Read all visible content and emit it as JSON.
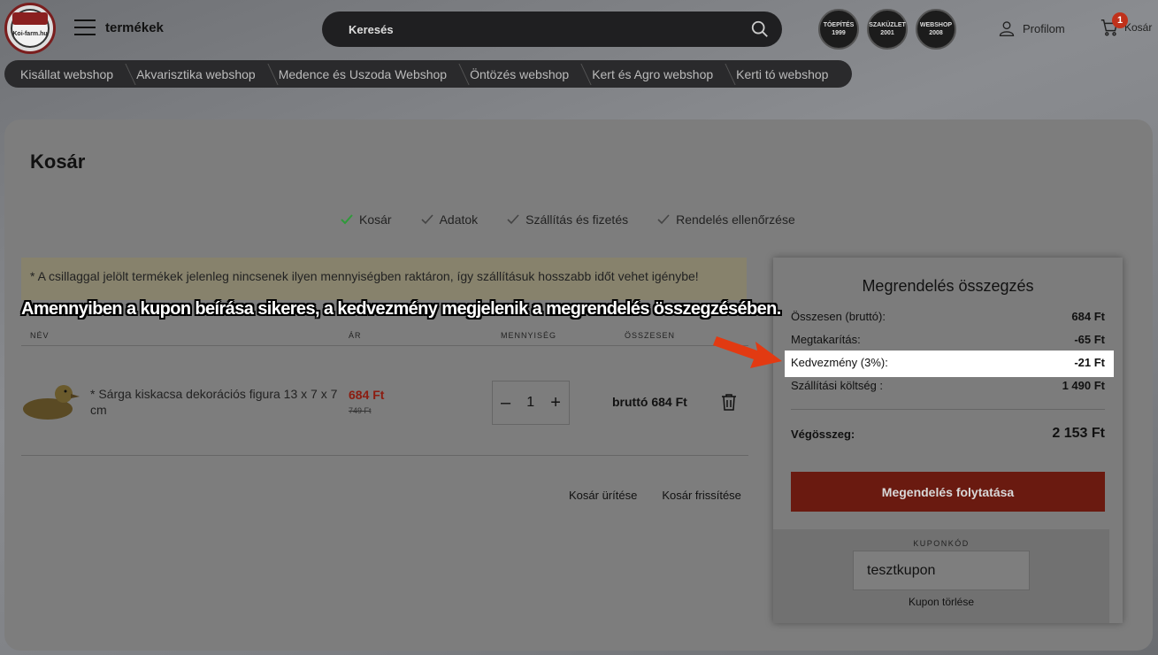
{
  "header": {
    "logo_text": "Koi-farm.hu",
    "menu_label": "termékek",
    "search_placeholder": "Keresés",
    "badges": [
      {
        "line1": "TÓEPÍTÉS",
        "line2": "1999"
      },
      {
        "line1": "SZAKÜZLET",
        "line2": "2001"
      },
      {
        "line1": "WEBSHOP",
        "line2": "2008"
      }
    ],
    "profile_label": "Profilom",
    "cart_label": "Kosár",
    "cart_count": "1"
  },
  "nav": {
    "items": [
      "Kisállat webshop",
      "Akvarisztika webshop",
      "Medence és Uszoda Webshop",
      "Öntözés webshop",
      "Kert és Agro webshop",
      "Kerti tó webshop"
    ]
  },
  "page": {
    "title": "Kosár",
    "steps": [
      "Kosár",
      "Adatok",
      "Szállítás és fizetés",
      "Rendelés ellenőrzése"
    ],
    "notice": "* A csillaggal jelölt termékek jelenleg nincsenek ilyen mennyiségben raktáron, így szállításuk hosszabb időt vehet igénybe!",
    "caption": "Amennyiben a kupon beírása sikeres, a kedvezmény megjelenik a megrendelés összegzésében."
  },
  "table": {
    "headers": [
      "NÉV",
      "ÁR",
      "MENNYISÉG",
      "ÖSSZESEN"
    ],
    "row": {
      "name": "* Sárga kiskacsa dekorációs figura 13 x 7 x 7 cm",
      "price_now": "684 Ft",
      "price_old": "749 Ft",
      "qty_minus": "–",
      "qty": "1",
      "qty_plus": "+",
      "total": "bruttó  684 Ft"
    },
    "actions": {
      "clear": "Kosár ürítése",
      "refresh": "Kosár frissítése"
    }
  },
  "summary": {
    "title": "Megrendelés összegzés",
    "rows": [
      {
        "label": "Összesen (bruttó):",
        "value": "684 Ft"
      },
      {
        "label": "Megtakarítás:",
        "value": "-65 Ft"
      },
      {
        "label": "Kedvezmény (3%):",
        "value": "-21 Ft"
      },
      {
        "label": "Szállítási költség :",
        "value": "1 490 Ft"
      }
    ],
    "total_label": "Végösszeg:",
    "total_value": "2 153 Ft",
    "checkout_label": "Megendelés folytatása",
    "coupon": {
      "label": "KUPONKÓD",
      "value": "tesztkupon",
      "remove_label": "Kupon törlése"
    }
  },
  "colors": {
    "accent_red": "#6a1a10",
    "arrow": "#e23a12",
    "check_green": "#2f9a3a"
  }
}
